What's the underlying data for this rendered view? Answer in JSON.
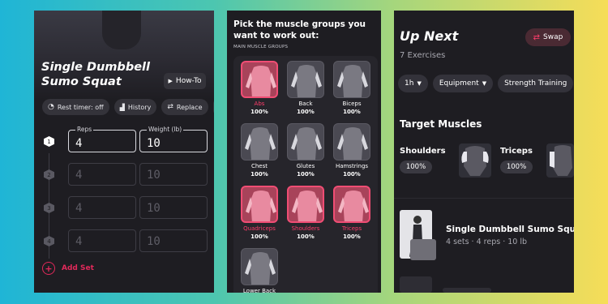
{
  "workout_screen": {
    "exercise_title": "Single Dumbbell Sumo Squat",
    "howto_label": "How-To",
    "chips": [
      {
        "icon": "timer-icon",
        "label": "Rest timer: off"
      },
      {
        "icon": "chart-icon",
        "label": "History"
      },
      {
        "icon": "replace-icon",
        "label": "Replace"
      }
    ],
    "reps_label": "Reps",
    "weight_label": "Weight (lb)",
    "sets": [
      {
        "num": "1",
        "reps": "4",
        "weight": "10",
        "active": true
      },
      {
        "num": "2",
        "reps": "4",
        "weight": "10",
        "active": false
      },
      {
        "num": "3",
        "reps": "4",
        "weight": "10",
        "active": false
      },
      {
        "num": "4",
        "reps": "4",
        "weight": "10",
        "active": false
      }
    ],
    "add_set_label": "Add Set"
  },
  "muscle_picker": {
    "title": "Pick the muscle groups you want to work out:",
    "section_label": "MAIN MUSCLE GROUPS",
    "muscles": [
      {
        "name": "Abs",
        "pct": "100%",
        "selected": true
      },
      {
        "name": "Back",
        "pct": "100%",
        "selected": false
      },
      {
        "name": "Biceps",
        "pct": "100%",
        "selected": false
      },
      {
        "name": "Chest",
        "pct": "100%",
        "selected": false
      },
      {
        "name": "Glutes",
        "pct": "100%",
        "selected": false
      },
      {
        "name": "Hamstrings",
        "pct": "100%",
        "selected": false
      },
      {
        "name": "Quadriceps",
        "pct": "100%",
        "selected": true
      },
      {
        "name": "Shoulders",
        "pct": "100%",
        "selected": true
      },
      {
        "name": "Triceps",
        "pct": "100%",
        "selected": true
      },
      {
        "name": "Lower Back",
        "pct": "",
        "selected": false
      }
    ]
  },
  "up_next": {
    "title": "Up Next",
    "swap_label": "Swap",
    "exercise_count": "7 Exercises",
    "filters": [
      {
        "label": "1h"
      },
      {
        "label": "Equipment"
      },
      {
        "label": "Strength Training"
      }
    ],
    "target_title": "Target Muscles",
    "targets": [
      {
        "name": "Shoulders",
        "pct": "100%"
      },
      {
        "name": "Triceps",
        "pct": "100%"
      }
    ],
    "next_exercise": {
      "name": "Single Dumbbell Sumo Squat",
      "meta": "4 sets · 4 reps · 10 lb"
    }
  },
  "colors": {
    "accent": "#ff3d6b",
    "panel": "#1e1d22"
  }
}
